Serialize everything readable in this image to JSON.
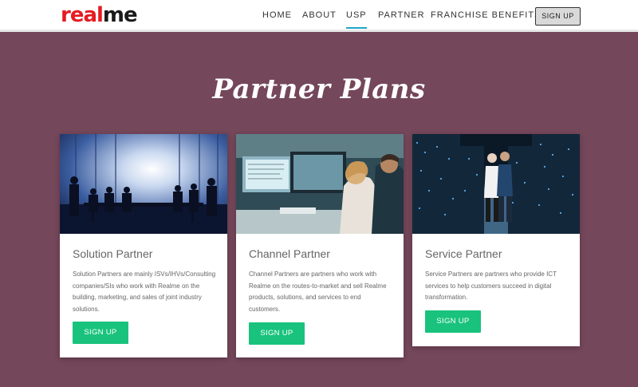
{
  "brand": {
    "logo_red": "real",
    "logo_dark": "me"
  },
  "nav": {
    "items": [
      {
        "label": "HOME"
      },
      {
        "label": "ABOUT"
      },
      {
        "label": "USP"
      },
      {
        "label": "PARTNER"
      },
      {
        "label": "FRANCHISE BENEFITS"
      }
    ],
    "active": "USP",
    "signup_label": "SIGN UP"
  },
  "page": {
    "title": "Partner Plans"
  },
  "cards": [
    {
      "title": "Solution Partner",
      "description": "Solution Partners are mainly ISVs/IHVs/Consulting companies/SIs who work with Realme on the building, marketing, and sales of joint industry solutions.",
      "button_label": "SIGN UP"
    },
    {
      "title": "Channel Partner",
      "description": "Channel Partners are partners who work with Realme on the routes-to-market and sell Realme products, solutions, and services to end customers.",
      "button_label": "SIGN UP"
    },
    {
      "title": "Service Partner",
      "description": "Service Partners are partners who provide ICT services to help customers succeed in digital transformation.",
      "button_label": "SIGN UP"
    }
  ],
  "colors": {
    "background": "#74475a",
    "accent_button": "#19c37d",
    "logo_red": "#e51b23",
    "nav_active_underline": "#1ea7c5"
  }
}
